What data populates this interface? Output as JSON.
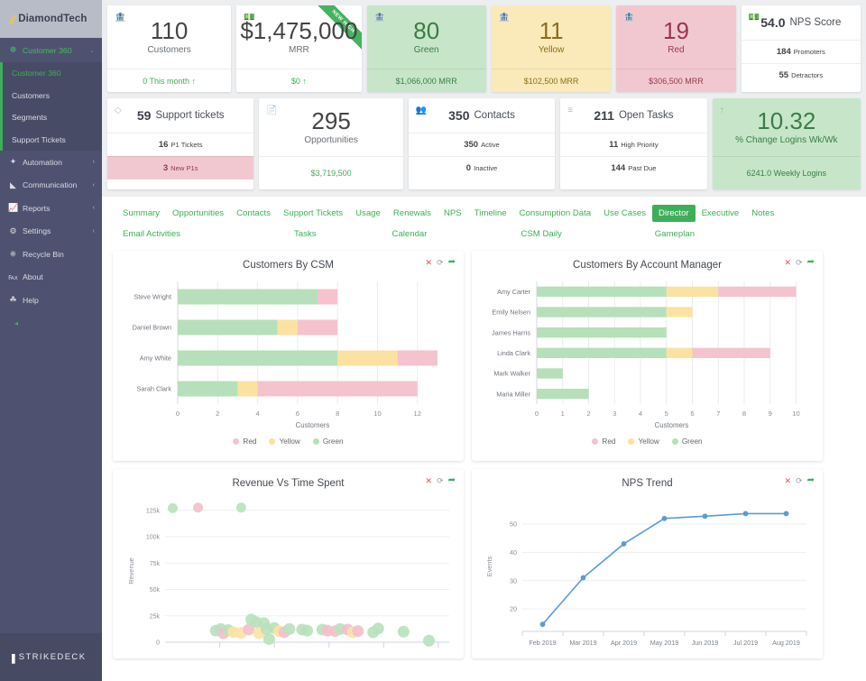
{
  "brand": {
    "logo": "//",
    "name": "DiamondTech"
  },
  "sidebar": {
    "group": {
      "label": "Customer 360",
      "icon": "users-icon",
      "caret": "⌄"
    },
    "submenu": [
      {
        "label": "Customer 360",
        "active": true
      },
      {
        "label": "Customers",
        "active": false
      },
      {
        "label": "Segments",
        "active": false
      },
      {
        "label": "Support Tickets",
        "active": false
      }
    ],
    "items": [
      {
        "label": "Automation",
        "icon": "wand-icon",
        "caret": "‹"
      },
      {
        "label": "Communication",
        "icon": "megaphone-icon",
        "caret": "‹"
      },
      {
        "label": "Reports",
        "icon": "chart-icon",
        "caret": "‹"
      },
      {
        "label": "Settings",
        "icon": "gear-icon",
        "caret": "‹"
      },
      {
        "label": "Recycle Bin",
        "icon": "trash-icon",
        "caret": ""
      },
      {
        "label": "About",
        "icon": "info-icon",
        "caret": ""
      },
      {
        "label": "Help",
        "icon": "help-icon",
        "caret": ""
      }
    ],
    "collapse": "◂",
    "footer": {
      "mark": "▮",
      "text": "STRIKEDECK"
    }
  },
  "kpis": {
    "row1": [
      {
        "id": "customers",
        "value": "110",
        "label": "Customers",
        "foot": "0 This month ↑",
        "tone": "white",
        "icon": "bank-icon",
        "ribbon": ""
      },
      {
        "id": "mrr",
        "value": "$1,475,000",
        "label": "MRR",
        "foot": "$0 ↑",
        "tone": "white",
        "icon": "money-icon",
        "ribbon": "NEW HIGH"
      },
      {
        "id": "green",
        "value": "80",
        "label": "Green",
        "foot": "$1,066,000 MRR",
        "tone": "green",
        "icon": "bank-icon",
        "ribbon": ""
      },
      {
        "id": "yellow",
        "value": "11",
        "label": "Yellow",
        "foot": "$102,500 MRR",
        "tone": "yellow",
        "icon": "bank-icon",
        "ribbon": ""
      },
      {
        "id": "red",
        "value": "19",
        "label": "Red",
        "foot": "$306,500 MRR",
        "tone": "red",
        "icon": "bank-icon",
        "ribbon": ""
      }
    ],
    "nps_card": {
      "value": "54.0",
      "label": "NPS Score",
      "icon": "money-icon",
      "rows": [
        {
          "num": "184",
          "text": "Promoters"
        },
        {
          "num": "55",
          "text": "Detractors"
        }
      ]
    },
    "row2": [
      {
        "id": "support-tickets",
        "num": "59",
        "label": "Support tickets",
        "icon": "ticket-icon",
        "rows": [
          {
            "num": "16",
            "text": "P1 Tickets",
            "tone": "plain"
          },
          {
            "num": "3",
            "text": "New P1s",
            "tone": "red"
          }
        ]
      },
      {
        "id": "opportunities",
        "value": "295",
        "label": "Opportunities",
        "icon": "doc-icon",
        "foot": "$3,719,500"
      },
      {
        "id": "contacts",
        "num": "350",
        "label": "Contacts",
        "icon": "contacts-icon",
        "rows": [
          {
            "num": "350",
            "text": "Active",
            "tone": "plain"
          },
          {
            "num": "0",
            "text": "Inactive",
            "tone": "plain"
          }
        ]
      },
      {
        "id": "open-tasks",
        "num": "211",
        "label": "Open Tasks",
        "icon": "tasks-icon",
        "rows": [
          {
            "num": "11",
            "text": "High Priority",
            "tone": "plain"
          },
          {
            "num": "144",
            "text": "Past Due",
            "tone": "plain"
          }
        ]
      },
      {
        "id": "logins",
        "value": "10.32",
        "label": "% Change Logins Wk/Wk",
        "icon": "arrow-up-icon",
        "foot": "6241.0 Weekly Logins",
        "tone": "green"
      }
    ]
  },
  "tabs": {
    "row1": [
      {
        "label": "Summary",
        "active": false
      },
      {
        "label": "Opportunities",
        "active": false
      },
      {
        "label": "Contacts",
        "active": false
      },
      {
        "label": "Support Tickets",
        "active": false
      },
      {
        "label": "Usage",
        "active": false
      },
      {
        "label": "Renewals",
        "active": false
      },
      {
        "label": "NPS",
        "active": false
      },
      {
        "label": "Timeline",
        "active": false
      },
      {
        "label": "Consumption Data",
        "active": false
      },
      {
        "label": "Use Cases",
        "active": false
      },
      {
        "label": "Director",
        "active": true
      },
      {
        "label": "Executive",
        "active": false
      },
      {
        "label": "Notes",
        "active": false
      }
    ],
    "row2": [
      {
        "label": "Email Activities",
        "pad": 0
      },
      {
        "label": "Tasks",
        "pad": 112
      },
      {
        "label": "Calendar",
        "pad": 70
      },
      {
        "label": "CSM Daily",
        "pad": 90
      },
      {
        "label": "Gameplan",
        "pad": 89
      }
    ]
  },
  "card_icons": {
    "close": "✕",
    "refresh": "⟳",
    "expand": "➦"
  },
  "chart_data": [
    {
      "id": "customers-by-csm",
      "type": "bar",
      "orientation": "horizontal",
      "stacked": true,
      "title": "Customers By CSM",
      "xlabel": "Customers",
      "ylabel": "",
      "xlim": [
        0,
        13.5
      ],
      "xticks": [
        0,
        2,
        4,
        6,
        8,
        10,
        12
      ],
      "categories": [
        "Steve Wright",
        "Daniel Brown",
        "Amy White",
        "Sarah Clark"
      ],
      "series": [
        {
          "name": "Green",
          "color": "#b6e0b9",
          "values": [
            7,
            5,
            8,
            3
          ]
        },
        {
          "name": "Yellow",
          "color": "#fbe2a0",
          "values": [
            0,
            1,
            3,
            1
          ]
        },
        {
          "name": "Red",
          "color": "#f4c3ce",
          "values": [
            1,
            2,
            2,
            8
          ]
        }
      ],
      "legend": [
        "Red",
        "Yellow",
        "Green"
      ],
      "legend_position": "bottom",
      "grid": true
    },
    {
      "id": "customers-by-account-manager",
      "type": "bar",
      "orientation": "horizontal",
      "stacked": true,
      "title": "Customers By Account Manager",
      "xlabel": "Customers",
      "ylabel": "",
      "xlim": [
        0,
        10.4
      ],
      "xticks": [
        0,
        1,
        2,
        3,
        4,
        5,
        6,
        7,
        8,
        9,
        10
      ],
      "categories": [
        "Amy Carter",
        "Emily Nelsen",
        "James Harris",
        "Linda Clark",
        "Mark Walker",
        "Maria Miller"
      ],
      "series": [
        {
          "name": "Green",
          "color": "#b6e0b9",
          "values": [
            5,
            5,
            5,
            5,
            1,
            2
          ]
        },
        {
          "name": "Yellow",
          "color": "#fbe2a0",
          "values": [
            2,
            1,
            0,
            1,
            0,
            0
          ]
        },
        {
          "name": "Red",
          "color": "#f4c3ce",
          "values": [
            3,
            0,
            0,
            3,
            0,
            0
          ]
        }
      ],
      "legend": [
        "Red",
        "Yellow",
        "Green"
      ],
      "legend_position": "bottom",
      "grid": true
    },
    {
      "id": "revenue-vs-time-spent",
      "type": "scatter",
      "title": "Revenue Vs Time Spent",
      "xlabel": "",
      "ylabel": "Revenue",
      "ylim": [
        0,
        135000
      ],
      "yticks": [
        0,
        25000,
        50000,
        75000,
        100000,
        125000
      ],
      "yticklabels": [
        "0",
        "25k",
        "50k",
        "75k",
        "100k",
        "125k"
      ],
      "grid": true,
      "points": [
        {
          "x": 1.5,
          "y": 127000,
          "c": "green"
        },
        {
          "x": 6.5,
          "y": 127500,
          "c": "red"
        },
        {
          "x": 15,
          "y": 127500,
          "c": "green"
        },
        {
          "x": 10,
          "y": 11000,
          "c": "green"
        },
        {
          "x": 11,
          "y": 12500,
          "c": "green"
        },
        {
          "x": 11.5,
          "y": 8500,
          "c": "red"
        },
        {
          "x": 12.5,
          "y": 11500,
          "c": "green"
        },
        {
          "x": 13.5,
          "y": 9500,
          "c": "yellow"
        },
        {
          "x": 15,
          "y": 9000,
          "c": "yellow"
        },
        {
          "x": 16.5,
          "y": 12000,
          "c": "red"
        },
        {
          "x": 17,
          "y": 21500,
          "c": "green"
        },
        {
          "x": 18,
          "y": 19000,
          "c": "green"
        },
        {
          "x": 18.5,
          "y": 8500,
          "c": "yellow"
        },
        {
          "x": 19.5,
          "y": 18000,
          "c": "green"
        },
        {
          "x": 20,
          "y": 12500,
          "c": "green"
        },
        {
          "x": 20.5,
          "y": 3000,
          "c": "green"
        },
        {
          "x": 21.5,
          "y": 13500,
          "c": "green"
        },
        {
          "x": 22.5,
          "y": 10500,
          "c": "yellow"
        },
        {
          "x": 23.5,
          "y": 9500,
          "c": "red"
        },
        {
          "x": 24.5,
          "y": 12500,
          "c": "green"
        },
        {
          "x": 27,
          "y": 12000,
          "c": "green"
        },
        {
          "x": 28,
          "y": 11000,
          "c": "green"
        },
        {
          "x": 31,
          "y": 12000,
          "c": "green"
        },
        {
          "x": 32,
          "y": 11000,
          "c": "red"
        },
        {
          "x": 33.5,
          "y": 10500,
          "c": "red"
        },
        {
          "x": 34.5,
          "y": 12500,
          "c": "green"
        },
        {
          "x": 36,
          "y": 12000,
          "c": "red"
        },
        {
          "x": 37,
          "y": 9500,
          "c": "yellow"
        },
        {
          "x": 38,
          "y": 10500,
          "c": "red"
        },
        {
          "x": 41,
          "y": 9500,
          "c": "green"
        },
        {
          "x": 42,
          "y": 13000,
          "c": "green"
        },
        {
          "x": 47,
          "y": 10000,
          "c": "green"
        },
        {
          "x": 52,
          "y": 1500,
          "c": "green"
        }
      ]
    },
    {
      "id": "nps-trend",
      "type": "line",
      "title": "NPS Trend",
      "xlabel": "",
      "ylabel": "Events",
      "ylim": [
        12,
        58
      ],
      "yticks": [
        20,
        30,
        40,
        50
      ],
      "categories": [
        "Feb 2019",
        "Mar 2019",
        "Apr 2019",
        "May 2019",
        "Jun 2019",
        "Jul 2019",
        "Aug 2019"
      ],
      "series": [
        {
          "name": "NPS",
          "color": "#5b9bd5",
          "values": [
            14.5,
            31,
            43,
            52,
            52.8,
            53.7,
            53.7
          ]
        }
      ],
      "grid": true,
      "legend_position": "none"
    }
  ],
  "colors": {
    "accent_green": "#3fae5a",
    "sidebar": "#4e5270",
    "green_card": "#c7e6c9",
    "yellow_card": "#faeab9",
    "red_card": "#f2c8d0",
    "line_blue": "#5b9bd5"
  }
}
